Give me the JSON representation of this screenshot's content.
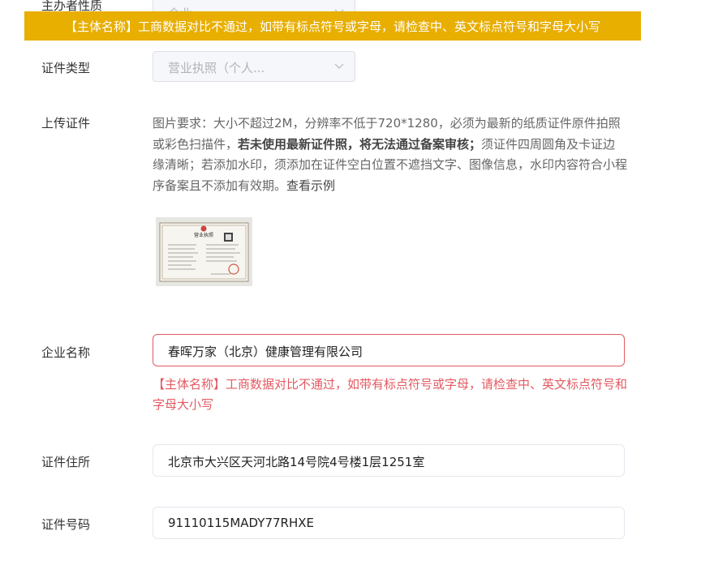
{
  "form": {
    "sponsor_nature_label": "主办者性质",
    "sponsor_nature_value": "企业",
    "cert_type_label": "证件类型",
    "cert_type_value": "营业执照（个人...",
    "upload_label": "上传证件",
    "upload_desc_1": "图片要求：大小不超过2M，分辨率不低于720*1280，必须为最新的纸质证件原件拍照或彩色扫描件，",
    "upload_desc_bold": "若未使用最新证件照，将无法通过备案审核；",
    "upload_desc_2": "须证件四周圆角及卡证边缘清晰；若添加水印，须添加在证件空白位置不遮挡文字、图像信息，水印内容符合小程序备案且不添加有效期。",
    "upload_example_link": "查看示例",
    "license_title": "营业执照",
    "company_name_label": "企业名称",
    "company_name_value": "春晖万家（北京）健康管理有限公司",
    "company_name_error": "【主体名称】工商数据对比不通过，如带有标点符号或字母，请检查中、英文标点符号和字母大小写",
    "address_label": "证件住所",
    "address_value": "北京市大兴区天河北路14号院4号楼1层1251室",
    "cert_number_label": "证件号码",
    "cert_number_value": "91110115MADY77RHXE"
  },
  "toast": {
    "message": "【主体名称】工商数据对比不通过，如带有标点符号或字母，请检查中、英文标点符号和字母大小写"
  },
  "colors": {
    "toast_bg": "#e8ae00",
    "error": "#e35a62",
    "disabled_bg": "#f5f7fa"
  }
}
